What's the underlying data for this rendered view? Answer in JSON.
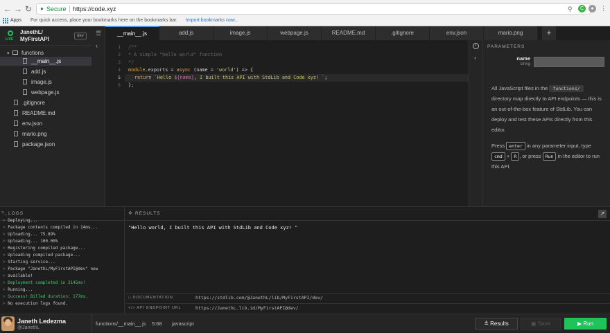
{
  "browser": {
    "secure_label": "Secure",
    "url": "https://code.xyz",
    "bookmarks": {
      "apps": "Apps",
      "hint": "For quick access, place your bookmarks here on the bookmarks bar.",
      "import": "Import bookmarks now..."
    }
  },
  "project": {
    "name_line1": "JanethL/",
    "name_line2": "MyFirstAPI",
    "env": "dev",
    "logo_text": "LIVE"
  },
  "tree": {
    "functions_folder": "functions",
    "files_in_functions": [
      "__main__.js",
      "add.js",
      "image.js",
      "webpage.js"
    ],
    "root_files": [
      ".gitignore",
      "README.md",
      "env.json",
      "mario.png",
      "package.json"
    ]
  },
  "tabs": [
    "__main__.js",
    "add.js",
    "image.js",
    "webpage.js",
    "README.md",
    ".gitignore",
    "env.json",
    "mario.png"
  ],
  "add_tab": "+",
  "editor": {
    "line_numbers": [
      "1",
      "2",
      "3",
      "4",
      "5",
      "6"
    ],
    "line1": "/**",
    "line2": "* A simple \"hello world\" function",
    "line3": "*/",
    "line4_kw1": "module",
    "line4_p1": ".exports = ",
    "line4_kw2": "async",
    "line4_p2": " (name = ",
    "line4_str": "'world'",
    "line4_p3": ") => {",
    "line5_kw": "return",
    "line5_s1": "`Hello ",
    "line5_var": "${name}",
    "line5_s2": ", I built this API with StdLib and Code xyz! `",
    "line5_end": ";",
    "line6": "};"
  },
  "parameters": {
    "heading": "PARAMETERS",
    "param_name": "name",
    "param_type": "string",
    "desc_p1": "All JavaScript files in the",
    "desc_chip": "functions/",
    "desc_p2": "directory map directly to API endpoints — this is an out-of-the-box feature of StdLib. You can deploy and test these APIs directly from this editor.",
    "press": "Press",
    "key_enter": "enter",
    "desc_p3": "in any parameter input, type",
    "key_cmd": "cmd",
    "plus": "+",
    "key_r": "R",
    "desc_p4": ", or press",
    "key_run": "Run",
    "desc_p5": "in the editor to run this API."
  },
  "logs": {
    "heading": "LOGS",
    "lines": [
      {
        "text": "Deploying...",
        "green": false
      },
      {
        "text": "Package contents compiled in 14ms...",
        "green": false
      },
      {
        "text": "Uploading... 75.89%",
        "green": false
      },
      {
        "text": "Uploading... 100.00%",
        "green": false
      },
      {
        "text": "Registering compiled package...",
        "green": false
      },
      {
        "text": "Uploading compiled package...",
        "green": false
      },
      {
        "text": "Starting service...",
        "green": false
      },
      {
        "text": "Package \"JanethL/MyFirstAPI@dev\" now",
        "green": false
      },
      {
        "text": "available!",
        "green": false
      },
      {
        "text": "Deployment completed in 3145ms!",
        "green": true
      },
      {
        "text": "Running...",
        "green": false
      },
      {
        "text": "Success! Billed duration: 177ms.",
        "green": true
      },
      {
        "text": "No execution logs found.",
        "green": false
      }
    ]
  },
  "results": {
    "heading": "RESULTS",
    "output": "\"Hello world, I built this API with StdLib and Code xyz! \"",
    "doc_label": "DOCUMENTATION",
    "doc_url": "https://stdlib.com/@JanethL/lib/MyFirstAPI/dev/",
    "endpoint_label": "API ENDPOINT URL",
    "endpoint_url": "https://JanethL.lib.id/MyFirstAPI@dev/"
  },
  "status": {
    "user_name": "Janeth Ledezma",
    "user_handle": "@JanethL",
    "file": "functions/__main__.js",
    "position": "5:68",
    "language": "javascript",
    "results_btn": "Results",
    "save_btn": "Save",
    "run_btn": "Run"
  },
  "colors": {
    "accent_green": "#1fc35a",
    "tab_active_border": "#3a8ee6"
  }
}
